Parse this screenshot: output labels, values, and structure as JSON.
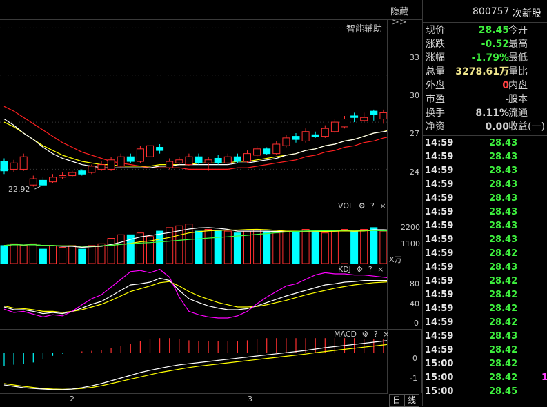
{
  "header": {
    "hide_label": "隐藏",
    "hide_icon": "double-chevron-right-icon",
    "stock_code": "800757",
    "stock_name": "次新股"
  },
  "main_chart": {
    "assist_label": "智能辅助",
    "price_ticks": [
      "33",
      "30",
      "27",
      "24"
    ],
    "low_marker": "22.92"
  },
  "vol_panel": {
    "title": "VOL",
    "ticks": [
      "2200",
      "1100"
    ],
    "unit": "X万"
  },
  "kdj_panel": {
    "title": "KDJ",
    "ticks": [
      "80",
      "40",
      "0"
    ]
  },
  "macd_panel": {
    "title": "MACD",
    "ticks": [
      "0",
      "-1"
    ]
  },
  "panel_tools": {
    "gear": "gear-icon",
    "help": "?",
    "close": "×"
  },
  "x_axis": {
    "labels": [
      "2",
      "3"
    ]
  },
  "period_buttons": [
    "日",
    "线"
  ],
  "quote": {
    "rows": [
      {
        "label": "现价",
        "value": "28.45",
        "label2": "今开",
        "color": "#3ef03e"
      },
      {
        "label": "涨跌",
        "value": "-0.52",
        "label2": "最高",
        "color": "#3ef03e"
      },
      {
        "label": "涨幅",
        "value": "-1.79%",
        "label2": "最低",
        "color": "#3ef03e"
      },
      {
        "label": "总量",
        "value": "3278.61万",
        "label2": "量比",
        "color": "#f0e68c"
      },
      {
        "label": "外盘",
        "value": "0",
        "label2": "内盘",
        "color": "#ff4040"
      },
      {
        "label": "市盈",
        "value": "-",
        "label2": "股本",
        "color": "#d0d0d0"
      },
      {
        "label": "换手",
        "value": "8.11%",
        "label2": "流通",
        "color": "#d0d0d0"
      },
      {
        "label": "净资",
        "value": "0.00",
        "label2": "收益(一)",
        "color": "#d0d0d0"
      }
    ]
  },
  "ticks": [
    {
      "time": "14:59",
      "price": "28.43",
      "vol": ""
    },
    {
      "time": "14:59",
      "price": "28.43",
      "vol": ""
    },
    {
      "time": "14:59",
      "price": "28.43",
      "vol": ""
    },
    {
      "time": "14:59",
      "price": "28.43",
      "vol": ""
    },
    {
      "time": "14:59",
      "price": "28.43",
      "vol": ""
    },
    {
      "time": "14:59",
      "price": "28.43",
      "vol": ""
    },
    {
      "time": "14:59",
      "price": "28.43",
      "vol": ""
    },
    {
      "time": "14:59",
      "price": "28.43",
      "vol": ""
    },
    {
      "time": "14:59",
      "price": "28.42",
      "vol": ""
    },
    {
      "time": "14:59",
      "price": "28.43",
      "vol": ""
    },
    {
      "time": "14:59",
      "price": "28.42",
      "vol": ""
    },
    {
      "time": "14:59",
      "price": "28.42",
      "vol": ""
    },
    {
      "time": "14:59",
      "price": "28.42",
      "vol": ""
    },
    {
      "time": "14:59",
      "price": "28.42",
      "vol": ""
    },
    {
      "time": "14:59",
      "price": "28.43",
      "vol": ""
    },
    {
      "time": "14:59",
      "price": "28.42",
      "vol": ""
    },
    {
      "time": "15:00",
      "price": "28.42",
      "vol": ""
    },
    {
      "time": "15:00",
      "price": "28.42",
      "vol": "1"
    },
    {
      "time": "15:00",
      "price": "28.45",
      "vol": ""
    }
  ],
  "colors": {
    "up": "#ff3030",
    "down": "#00ffff",
    "ma_white": "#ffffff",
    "ma_yellow": "#ffff00",
    "ma_red": "#ff2020",
    "kdj_magenta": "#ff00ff",
    "grid": "#3a3a3a"
  },
  "chart_data": {
    "type": "candlestick",
    "candles": [
      {
        "o": 24.5,
        "c": 23.9,
        "h": 24.7,
        "l": 23.7
      },
      {
        "o": 24.0,
        "c": 24.4,
        "h": 24.6,
        "l": 23.8
      },
      {
        "o": 24.0,
        "c": 24.8,
        "h": 25.0,
        "l": 23.9
      },
      {
        "o": 23.0,
        "c": 23.4,
        "h": 23.6,
        "l": 22.9
      },
      {
        "o": 23.3,
        "c": 23.0,
        "h": 23.5,
        "l": 22.92
      },
      {
        "o": 23.2,
        "c": 23.5,
        "h": 23.7,
        "l": 23.1
      },
      {
        "o": 23.5,
        "c": 23.6,
        "h": 23.8,
        "l": 23.4
      },
      {
        "o": 23.6,
        "c": 23.8,
        "h": 23.9,
        "l": 23.5
      },
      {
        "o": 23.9,
        "c": 23.7,
        "h": 24.0,
        "l": 23.6
      },
      {
        "o": 23.8,
        "c": 24.2,
        "h": 24.3,
        "l": 23.7
      },
      {
        "o": 24.0,
        "c": 24.3,
        "h": 24.5,
        "l": 23.9
      },
      {
        "o": 24.0,
        "c": 24.6,
        "h": 24.8,
        "l": 23.9
      },
      {
        "o": 24.2,
        "c": 24.8,
        "h": 25.0,
        "l": 24.1
      },
      {
        "o": 24.8,
        "c": 24.5,
        "h": 25.0,
        "l": 24.4
      },
      {
        "o": 24.5,
        "c": 25.3,
        "h": 25.5,
        "l": 24.4
      },
      {
        "o": 24.8,
        "c": 25.5,
        "h": 25.7,
        "l": 24.7
      },
      {
        "o": 25.4,
        "c": 25.2,
        "h": 25.6,
        "l": 25.0
      },
      {
        "o": 24.1,
        "c": 24.5,
        "h": 24.7,
        "l": 24.0
      },
      {
        "o": 24.4,
        "c": 24.6,
        "h": 24.8,
        "l": 24.3
      },
      {
        "o": 24.3,
        "c": 24.8,
        "h": 25.0,
        "l": 24.2
      },
      {
        "o": 24.8,
        "c": 24.4,
        "h": 25.0,
        "l": 24.3
      },
      {
        "o": 24.4,
        "c": 24.6,
        "h": 24.8,
        "l": 23.9
      },
      {
        "o": 24.7,
        "c": 24.4,
        "h": 24.9,
        "l": 24.3
      },
      {
        "o": 24.4,
        "c": 24.8,
        "h": 25.0,
        "l": 24.3
      },
      {
        "o": 24.8,
        "c": 24.5,
        "h": 25.0,
        "l": 24.4
      },
      {
        "o": 24.5,
        "c": 25.0,
        "h": 25.2,
        "l": 24.4
      },
      {
        "o": 24.9,
        "c": 25.3,
        "h": 25.5,
        "l": 24.8
      },
      {
        "o": 25.3,
        "c": 25.0,
        "h": 25.4,
        "l": 24.9
      },
      {
        "o": 25.0,
        "c": 25.6,
        "h": 25.8,
        "l": 24.9
      },
      {
        "o": 25.5,
        "c": 26.0,
        "h": 26.2,
        "l": 25.4
      },
      {
        "o": 26.1,
        "c": 25.9,
        "h": 26.3,
        "l": 25.7
      },
      {
        "o": 25.8,
        "c": 26.4,
        "h": 26.6,
        "l": 25.7
      },
      {
        "o": 26.2,
        "c": 26.1,
        "h": 26.4,
        "l": 26.0
      },
      {
        "o": 26.1,
        "c": 26.6,
        "h": 26.8,
        "l": 26.0
      },
      {
        "o": 26.4,
        "c": 27.0,
        "h": 27.2,
        "l": 26.3
      },
      {
        "o": 26.7,
        "c": 27.2,
        "h": 27.4,
        "l": 26.6
      },
      {
        "o": 27.4,
        "c": 27.3,
        "h": 27.6,
        "l": 27.0
      },
      {
        "o": 27.1,
        "c": 27.3,
        "h": 27.6,
        "l": 27.0
      },
      {
        "o": 27.7,
        "c": 27.5,
        "h": 27.8,
        "l": 27.1
      },
      {
        "o": 27.2,
        "c": 27.6,
        "h": 27.8,
        "l": 26.9
      },
      {
        "o": 27.3,
        "c": 27.8,
        "h": 28.0,
        "l": 27.2
      },
      {
        "o": 27.6,
        "c": 28.0,
        "h": 28.2,
        "l": 27.5
      },
      {
        "o": 27.8,
        "c": 28.1,
        "h": 28.4,
        "l": 27.7
      },
      {
        "o": 28.0,
        "c": 28.4,
        "h": 28.6,
        "l": 27.9
      },
      {
        "o": 28.3,
        "c": 29.3,
        "h": 29.5,
        "l": 28.2
      },
      {
        "o": 29.3,
        "c": 28.45,
        "h": 29.8,
        "l": 28.3
      }
    ],
    "ma_white": [
      27.2,
      26.8,
      26.3,
      25.9,
      25.4,
      25.0,
      24.7,
      24.5,
      24.3,
      24.2,
      24.1,
      24.1,
      24.1,
      24.1,
      24.1,
      24.1,
      24.2,
      24.2,
      24.3,
      24.3,
      24.3,
      24.3,
      24.3,
      24.3,
      24.4,
      24.4,
      24.5,
      24.6,
      24.7,
      24.9,
      25.0,
      25.2,
      25.3,
      25.5,
      25.6,
      25.8,
      25.9,
      26.1,
      26.3,
      26.4,
      26.5,
      26.7,
      26.8,
      26.9,
      27.1,
      27.4
    ],
    "ma_yellow": [
      27.0,
      26.7,
      26.3,
      25.9,
      25.5,
      25.2,
      24.9,
      24.7,
      24.5,
      24.4,
      24.3,
      24.3,
      24.2,
      24.2,
      24.2,
      24.2,
      24.3,
      24.3,
      24.3,
      24.3,
      24.4,
      24.4,
      24.4,
      24.4,
      24.5,
      24.5,
      24.6,
      24.7,
      24.8,
      24.9,
      25.0,
      25.2,
      25.3,
      25.5,
      25.6,
      25.8,
      25.9,
      26.1,
      26.3,
      26.4,
      26.6,
      26.7,
      26.9,
      27.0,
      27.2,
      27.5
    ],
    "ma_red": [
      28.0,
      27.7,
      27.3,
      26.9,
      26.5,
      26.1,
      25.7,
      25.4,
      25.1,
      24.9,
      24.7,
      24.5,
      24.4,
      24.3,
      24.2,
      24.1,
      24.1,
      24.1,
      24.1,
      24.0,
      24.0,
      24.0,
      24.0,
      24.0,
      24.1,
      24.1,
      24.2,
      24.3,
      24.4,
      24.5,
      24.6,
      24.8,
      24.9,
      25.1,
      25.2,
      25.4,
      25.5,
      25.7,
      25.8,
      26.0,
      26.1,
      26.3,
      26.4,
      26.6,
      26.8,
      27.1
    ],
    "y_range": [
      22.0,
      33.5
    ],
    "volume": [
      1000,
      1100,
      1000,
      1100,
      800,
      1000,
      900,
      1000,
      800,
      1000,
      1100,
      1400,
      1600,
      1600,
      1700,
      1500,
      1800,
      2000,
      2100,
      2200,
      1800,
      1900,
      1800,
      1800,
      1700,
      1800,
      1900,
      1800,
      1700,
      1800,
      1800,
      1900,
      1800,
      1700,
      1800,
      1900,
      1800,
      1900,
      2000,
      1800,
      1800,
      1800,
      1900,
      1800,
      2600,
      3278.61
    ],
    "vol_range": [
      0,
      3300
    ],
    "kdj_k": [
      30,
      25,
      25,
      22,
      18,
      20,
      18,
      22,
      28,
      35,
      40,
      50,
      60,
      70,
      72,
      75,
      82,
      78,
      60,
      45,
      38,
      32,
      28,
      25,
      25,
      27,
      32,
      38,
      44,
      50,
      55,
      60,
      65,
      70,
      72,
      75,
      76,
      78,
      78,
      78,
      78,
      78,
      80,
      80,
      80,
      76
    ],
    "kdj_d": [
      32,
      28,
      27,
      25,
      22,
      22,
      20,
      22,
      25,
      30,
      35,
      42,
      50,
      58,
      63,
      68,
      74,
      76,
      68,
      58,
      50,
      44,
      38,
      34,
      30,
      30,
      31,
      34,
      38,
      42,
      47,
      52,
      56,
      60,
      64,
      67,
      70,
      72,
      74,
      75,
      76,
      76,
      77,
      78,
      78,
      77
    ],
    "kdj_j": [
      26,
      20,
      22,
      17,
      12,
      16,
      14,
      22,
      34,
      45,
      52,
      66,
      80,
      94,
      96,
      92,
      98,
      84,
      48,
      22,
      16,
      12,
      10,
      10,
      14,
      22,
      36,
      48,
      58,
      68,
      72,
      80,
      88,
      92,
      90,
      90,
      88,
      88,
      86,
      84,
      82,
      82,
      86,
      84,
      84,
      72
    ],
    "kdj_range": [
      0,
      100
    ],
    "macd_hist": [
      -0.25,
      -0.22,
      -0.2,
      -0.18,
      -0.12,
      -0.06,
      -0.02,
      0.0,
      0.02,
      0.03,
      0.04,
      0.08,
      0.12,
      0.16,
      0.2,
      0.24,
      0.26,
      0.26,
      0.24,
      0.22,
      0.2,
      0.2,
      0.2,
      0.2,
      0.2,
      0.22,
      0.24,
      0.26,
      0.26,
      0.26,
      0.26,
      0.26,
      0.26,
      0.26,
      0.26,
      0.26,
      0.26,
      0.24,
      0.24,
      0.24,
      0.24,
      0.22,
      0.22,
      0.22,
      0.3,
      0.22
    ],
    "macd_dif": [
      -1.25,
      -1.3,
      -1.35,
      -1.38,
      -1.4,
      -1.42,
      -1.42,
      -1.4,
      -1.35,
      -1.28,
      -1.2,
      -1.1,
      -1.0,
      -0.9,
      -0.8,
      -0.72,
      -0.65,
      -0.58,
      -0.52,
      -0.48,
      -0.44,
      -0.4,
      -0.36,
      -0.32,
      -0.28,
      -0.24,
      -0.2,
      -0.16,
      -0.12,
      -0.08,
      -0.04,
      0.0,
      0.05,
      0.1,
      0.14,
      0.18,
      0.22,
      0.26,
      0.3,
      0.34,
      0.38,
      0.42,
      0.46,
      0.5,
      0.6,
      0.65
    ],
    "macd_dea": [
      -1.2,
      -1.25,
      -1.3,
      -1.34,
      -1.38,
      -1.4,
      -1.41,
      -1.4,
      -1.38,
      -1.34,
      -1.28,
      -1.2,
      -1.12,
      -1.04,
      -0.96,
      -0.88,
      -0.8,
      -0.74,
      -0.68,
      -0.62,
      -0.57,
      -0.53,
      -0.49,
      -0.45,
      -0.41,
      -0.37,
      -0.33,
      -0.29,
      -0.25,
      -0.21,
      -0.17,
      -0.13,
      -0.08,
      -0.04,
      0.0,
      0.04,
      0.08,
      0.12,
      0.16,
      0.2,
      0.24,
      0.28,
      0.32,
      0.36,
      0.42,
      0.46
    ],
    "macd_range": [
      -1.55,
      0.75
    ]
  }
}
